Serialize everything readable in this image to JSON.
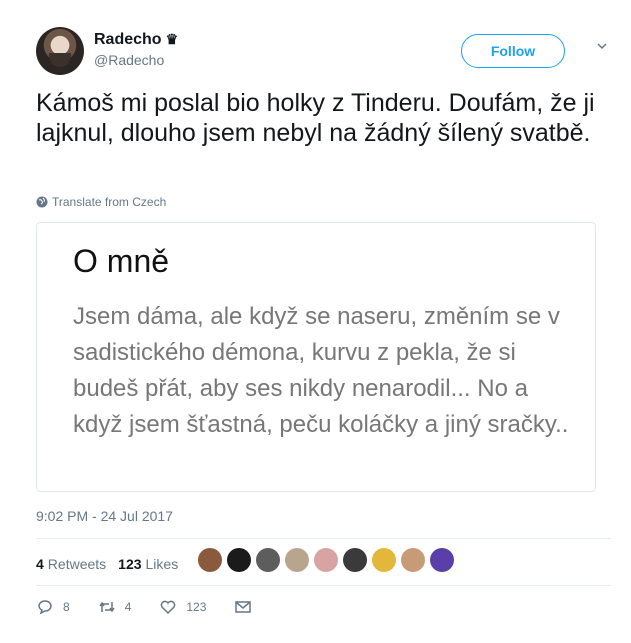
{
  "user": {
    "name": "Radecho",
    "badge": "♛",
    "handle": "@Radecho"
  },
  "follow_label": "Follow",
  "tweet_text": "Kámoš mi poslal bio holky z Tinderu. Doufám, že ji lajknul, dlouho jsem nebyl na žádný šílený svatbě.",
  "translate_label": "Translate from Czech",
  "card": {
    "title": "O mně",
    "body": "Jsem dáma, ale když se naseru, změním se v sadistického démona, kurvu z pekla, že si budeš přát, aby ses nikdy nenarodil... No a když jsem šťastná, peču koláčky a jiný sračky.."
  },
  "timestamp": "9:02 PM - 24 Jul 2017",
  "stats": {
    "retweets_count": "4",
    "retweets_label": "Retweets",
    "likes_count": "123",
    "likes_label": "Likes"
  },
  "liker_colors": [
    "#8a5a3c",
    "#1b1b1b",
    "#5d5d5d",
    "#b9a58e",
    "#d7a3a3",
    "#3a3a3a",
    "#e3b73a",
    "#c79a78",
    "#5b3fa8"
  ],
  "actions": {
    "replies": "8",
    "retweets": "4",
    "likes": "123"
  },
  "colors": {
    "accent": "#1da1f2",
    "muted": "#657786",
    "text": "#14171a"
  }
}
